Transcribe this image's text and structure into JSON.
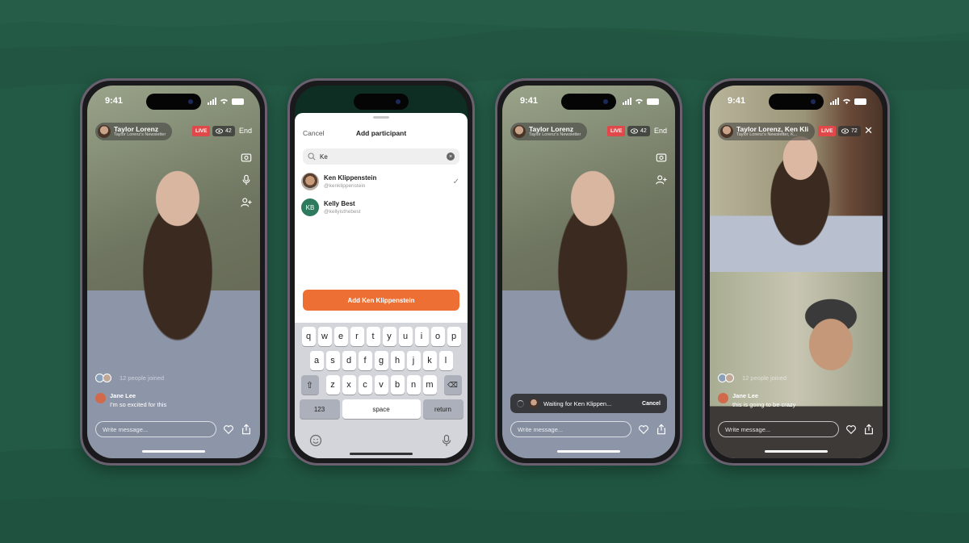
{
  "colors": {
    "background": "#235a46",
    "live_badge": "#e0484a",
    "accent_orange": "#ee6f33",
    "kb_avatar": "#2d7a5f"
  },
  "phones": [
    {
      "id": "broadcast",
      "status_time": "9:41",
      "host_name": "Taylor Lorenz",
      "host_sub": "Taylor Lorenz's Newsletter",
      "live_label": "LIVE",
      "viewers": "42",
      "end_label": "End",
      "side_icons": [
        "flip-camera-icon",
        "microphone-icon",
        "add-person-icon"
      ],
      "joined_text": "12 people joined",
      "comment": {
        "name": "Jane Lee",
        "message": "I'm so excited for this"
      },
      "message_placeholder": "Write message..."
    },
    {
      "id": "add-participant",
      "sheet_cancel": "Cancel",
      "sheet_title": "Add participant",
      "search_value": "Ke",
      "results": [
        {
          "name": "Ken Klippenstein",
          "handle": "@kenklippenstein",
          "selected": true
        },
        {
          "name": "Kelly Best",
          "handle": "@kellyisthebest",
          "initials": "KB",
          "selected": false
        }
      ],
      "add_button": "Add Ken Klippenstein",
      "keyboard": {
        "row1": [
          "q",
          "w",
          "e",
          "r",
          "t",
          "y",
          "u",
          "i",
          "o",
          "p"
        ],
        "row2": [
          "a",
          "s",
          "d",
          "f",
          "g",
          "h",
          "j",
          "k",
          "l"
        ],
        "row3": [
          "z",
          "x",
          "c",
          "v",
          "b",
          "n",
          "m"
        ],
        "numbers": "123",
        "space": "space",
        "return": "return"
      }
    },
    {
      "id": "waiting",
      "status_time": "9:41",
      "host_name": "Taylor Lorenz",
      "host_sub": "Taylor Lorenz's Newsletter",
      "live_label": "LIVE",
      "viewers": "42",
      "end_label": "End",
      "side_icons": [
        "flip-camera-icon",
        "add-person-icon"
      ],
      "waiting_text": "Waiting for Ken Klippen...",
      "waiting_cancel": "Cancel",
      "message_placeholder": "Write message..."
    },
    {
      "id": "split",
      "status_time": "9:41",
      "host_name": "Taylor Lorenz, Ken Kli",
      "host_sub": "Taylor Lorenz's Newsletter, K...",
      "live_label": "LIVE",
      "viewers": "72",
      "close_label": "✕",
      "joined_text": "12 people joined",
      "comment": {
        "name": "Jane Lee",
        "message": "this is going to be crazy"
      },
      "message_placeholder": "Write message..."
    }
  ]
}
